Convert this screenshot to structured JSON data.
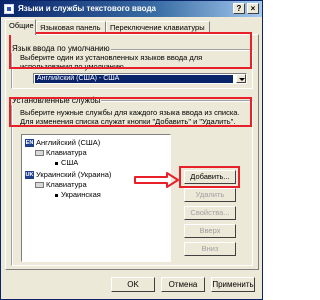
{
  "window": {
    "title": "Языки и службы текстового ввода",
    "controls": {
      "help": "?",
      "close": "×"
    }
  },
  "tabs": [
    {
      "label": "Общие",
      "active": true
    },
    {
      "label": "Языковая панель",
      "active": false
    },
    {
      "label": "Переключение клавиатуры",
      "active": false
    }
  ],
  "default_language": {
    "title": "Язык ввода по умолчанию",
    "description": "Выберите один из установленных языков ввода для использования по умолчанию.",
    "selected": "Английский (США) - США"
  },
  "installed_services": {
    "title": "Установленные службы",
    "description": "Выберите нужные службы для каждого языка ввода из списка. Для изменения списка служат кнопки \"Добавить\" и \"Удалить\".",
    "tree": [
      {
        "badge": "EN",
        "label": "Английский (США)"
      },
      {
        "label": "Клавиатура"
      },
      {
        "label": "США"
      },
      {
        "badge": "UK",
        "label": "Украинский (Украина)"
      },
      {
        "label": "Клавиатура"
      },
      {
        "label": "Украинская"
      }
    ]
  },
  "side_buttons": {
    "add": "Добавить...",
    "remove": "Удалить",
    "properties": "Свойства...",
    "up": "Вверх",
    "down": "Вниз"
  },
  "bottom_buttons": {
    "ok": "OK",
    "cancel": "Отмена",
    "apply": "Применить"
  },
  "colors": {
    "highlight": "#e8202a",
    "selection": "#0a246a",
    "dialog_bg": "#ece9d8"
  }
}
